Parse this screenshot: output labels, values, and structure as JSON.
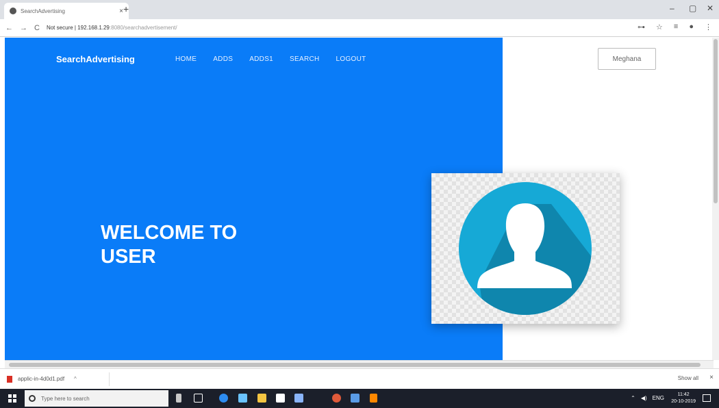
{
  "browser": {
    "tab_title": "SearchAdvertising",
    "tab_close": "×",
    "new_tab": "+",
    "window_controls": [
      "–",
      "▢",
      "✕"
    ],
    "nav": {
      "back": "←",
      "forward": "→",
      "reload": "C"
    },
    "security_label": "Not secure",
    "url_host": "192.168.1.29",
    "url_path": ":8080/searchadvertisement/",
    "tools": [
      "⊶",
      "☆",
      "≡",
      "●",
      "⋮"
    ]
  },
  "site": {
    "brand": "SearchAdvertising",
    "nav": [
      {
        "label": "HOME"
      },
      {
        "label": "ADDS"
      },
      {
        "label": "ADDS1"
      },
      {
        "label": "SEARCH"
      },
      {
        "label": "LOGOUT"
      }
    ],
    "user_button": "Meghana",
    "welcome_line1": "WELCOME TO",
    "welcome_line2": "USER",
    "hero_color": "#0a7cf8",
    "avatar_circle_color": "#16a9d6",
    "avatar_shadow_color": "#0f86ad"
  },
  "downloads": {
    "file_name": "applic-in-4d0d1.pdf",
    "chevron": "^",
    "show_all": "Show all",
    "close": "×"
  },
  "taskbar": {
    "search_placeholder": "Type here to search",
    "time": "11:42",
    "date": "20-10-2019",
    "lang": "ENG",
    "tray_icons": [
      "⌃",
      "◀)",
      "ENG"
    ]
  }
}
